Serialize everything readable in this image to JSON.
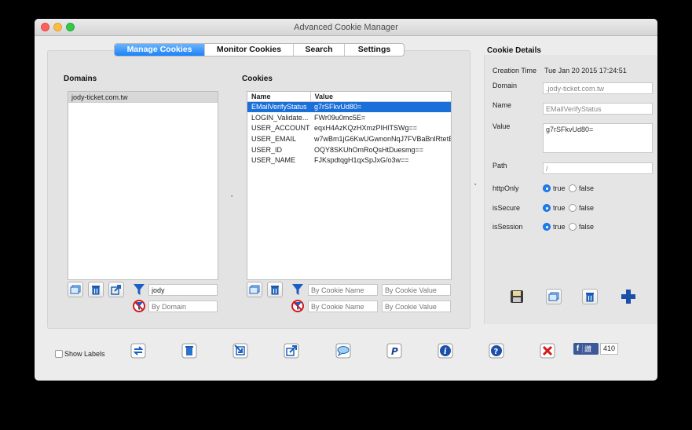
{
  "window": {
    "title": "Advanced Cookie Manager"
  },
  "tabs": [
    {
      "label": "Manage Cookies",
      "active": true
    },
    {
      "label": "Monitor Cookies",
      "active": false
    },
    {
      "label": "Search",
      "active": false
    },
    {
      "label": "Settings",
      "active": false
    }
  ],
  "domains": {
    "title": "Domains",
    "items": [
      "jody-ticket.com.tw"
    ],
    "filter_value": "jody",
    "exclude_placeholder": "By Domain"
  },
  "cookies": {
    "title": "Cookies",
    "columns": [
      "Name",
      "Value"
    ],
    "rows": [
      {
        "name": "EMailVerifyStatus",
        "value": "g7rSFkvUd80=",
        "selected": true
      },
      {
        "name": "LOGIN_Validate...",
        "value": "FWr09u0mc5E=",
        "selected": false
      },
      {
        "name": "USER_ACCOUNT",
        "value": "eqxH4AzKQzHXmzPIHlTSWg==",
        "selected": false
      },
      {
        "name": "USER_EMAIL",
        "value": "w7wBm1jG6KwUGwnonNqJ7FVBaBnlRtetB",
        "selected": false
      },
      {
        "name": "USER_ID",
        "value": "OQY8SKUhOmRoQsHtDuesmg==",
        "selected": false
      },
      {
        "name": "USER_NAME",
        "value": "FJKspdtqgH1qxSpJxG/o3w==",
        "selected": false
      }
    ],
    "filter_name_placeholder": "By Cookie Name",
    "filter_value_placeholder": "By Cookie Value",
    "exclude_name_placeholder": "By Cookie Name",
    "exclude_value_placeholder": "By Cookie Value"
  },
  "details": {
    "title": "Cookie Details",
    "creation_time_label": "Creation Time",
    "creation_time_value": "Tue Jan 20 2015 17:24:51",
    "domain_label": "Domain",
    "domain_value": ".jody-ticket.com.tw",
    "name_label": "Name",
    "name_value": "EMailVerifyStatus",
    "value_label": "Value",
    "value_value": "g7rSFkvUd80=",
    "path_label": "Path",
    "path_value": "/",
    "httponly_label": "httpOnly",
    "issecure_label": "isSecure",
    "issession_label": "isSession",
    "true_label": "true",
    "false_label": "false",
    "httponly": true,
    "issecure": true,
    "issession": true
  },
  "footer": {
    "show_labels": "Show Labels",
    "fb_label": "讚",
    "fb_count": "410"
  },
  "colors": {
    "accent": "#1a82fb",
    "selection": "#1b6fd9"
  }
}
